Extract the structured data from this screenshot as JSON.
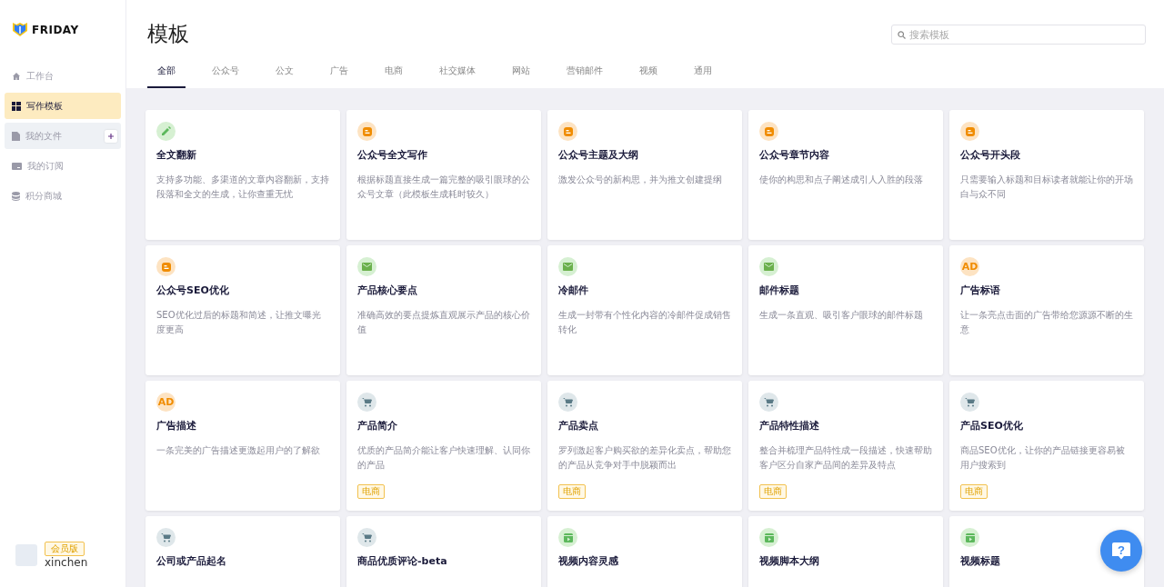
{
  "brand": {
    "name": "FRIDAY"
  },
  "sidebar": {
    "items": [
      {
        "label": "工作台",
        "selected": false,
        "hovered": false
      },
      {
        "label": "写作模板",
        "selected": true,
        "hovered": false
      },
      {
        "label": "我的文件",
        "selected": false,
        "hovered": true,
        "add_button": true
      },
      {
        "label": "我的订阅",
        "selected": false,
        "hovered": false
      },
      {
        "label": "积分商城",
        "selected": false,
        "hovered": false
      }
    ]
  },
  "help": {
    "label": "?"
  },
  "user": {
    "badge": "会员版",
    "name": "xinchen"
  },
  "header": {
    "title": "模板",
    "search": {
      "placeholder": "搜索模板"
    }
  },
  "tabs": [
    {
      "label": "全部",
      "selected": true
    },
    {
      "label": "公众号",
      "selected": false
    },
    {
      "label": "公文",
      "selected": false
    },
    {
      "label": "广告",
      "selected": false
    },
    {
      "label": "电商",
      "selected": false
    },
    {
      "label": "社交媒体",
      "selected": false
    },
    {
      "label": "网站",
      "selected": false
    },
    {
      "label": "营销邮件",
      "selected": false
    },
    {
      "label": "视频",
      "selected": false
    },
    {
      "label": "通用",
      "selected": false
    }
  ],
  "cards": [
    {
      "kind": "pencil",
      "title": "全文翻新",
      "description": "支持多功能、多渠道的文章内容翻新，支持段落和全文的生成，让你查重无忧"
    },
    {
      "kind": "blog",
      "title": "公众号全文写作",
      "description": "根据标题直接生成一篇完整的吸引眼球的公众号文章（此模板生成耗时较久）"
    },
    {
      "kind": "blog",
      "title": "公众号主题及大纲",
      "description": "激发公众号的新构思，并为推文创建提纲"
    },
    {
      "kind": "blog",
      "title": "公众号章节内容",
      "description": "使你的构思和点子阐述成引人入胜的段落"
    },
    {
      "kind": "blog",
      "title": "公众号开头段",
      "description": "只需要输入标题和目标读者就能让你的开场白与众不同"
    },
    {
      "kind": "blog",
      "title": "公众号SEO优化",
      "description": "SEO优化过后的标题和简述，让推文曝光度更高"
    },
    {
      "kind": "mail",
      "title": "产品核心要点",
      "description": "准确高效的要点提炼直观展示产品的核心价值"
    },
    {
      "kind": "mail",
      "title": "冷邮件",
      "description": "生成一封带有个性化内容的冷邮件促成销售转化"
    },
    {
      "kind": "mail",
      "title": "邮件标题",
      "description": "生成一条直观、吸引客户眼球的邮件标题"
    },
    {
      "kind": "ad",
      "icon_label": "AD",
      "title": "广告标语",
      "description": "让一条亮点击面的广告带给您源源不断的生意"
    },
    {
      "kind": "ad",
      "icon_label": "AD",
      "title": "广告描述",
      "description": "一条完美的广告描述更激起用户的了解欲"
    },
    {
      "kind": "cart",
      "title": "产品简介",
      "description": "优质的产品简介能让客户快速理解、认同你的产品",
      "tag": "电商"
    },
    {
      "kind": "cart",
      "title": "产品卖点",
      "description": "罗列激起客户购买欲的差异化卖点，帮助您的产品从竞争对手中脱颖而出",
      "tag": "电商"
    },
    {
      "kind": "cart",
      "title": "产品特性描述",
      "description": "整合并梳理产品特性成一段描述，快速帮助客户区分自家产品间的差异及特点",
      "tag": "电商"
    },
    {
      "kind": "cart",
      "title": "产品SEO优化",
      "description": "商品SEO优化，让你的产品链接更容易被用户搜索到",
      "tag": "电商"
    },
    {
      "kind": "cart",
      "title": "公司或产品起名"
    },
    {
      "kind": "cart",
      "title": "商品优质评论-beta"
    },
    {
      "kind": "video",
      "title": "视频内容灵感"
    },
    {
      "kind": "video",
      "title": "视频脚本大纲"
    },
    {
      "kind": "video",
      "title": "视频标题"
    }
  ]
}
